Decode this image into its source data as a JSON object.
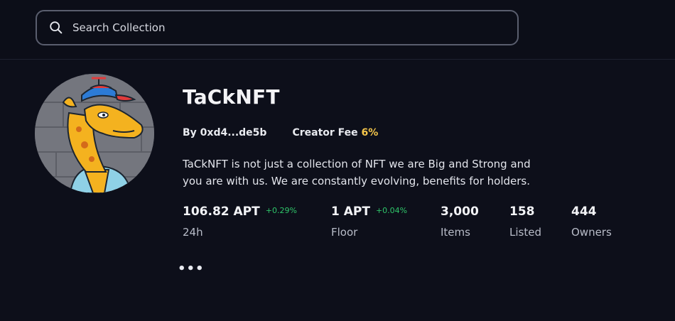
{
  "search": {
    "placeholder": "Search Collection"
  },
  "collection": {
    "name": "TaCkNFT",
    "creator_label": "By 0xd4...de5b",
    "fee_label": "Creator Fee",
    "fee_value": "6%",
    "description": "TaCkNFT is not just a collection of NFT we are Big and Strong and you are with us. We are constantly evolving, benefits for holders."
  },
  "stats": [
    {
      "value": "106.82 APT",
      "change": "+0.29%",
      "label": "24h"
    },
    {
      "value": "1 APT",
      "change": "+0.04%",
      "label": "Floor"
    },
    {
      "value": "3,000",
      "label": "Items"
    },
    {
      "value": "158",
      "label": "Listed"
    },
    {
      "value": "444",
      "label": "Owners"
    }
  ],
  "more_label": "•••",
  "colors": {
    "background": "#0d0f1a",
    "accent_fee": "#f5c64b",
    "positive": "#2fc56a"
  }
}
